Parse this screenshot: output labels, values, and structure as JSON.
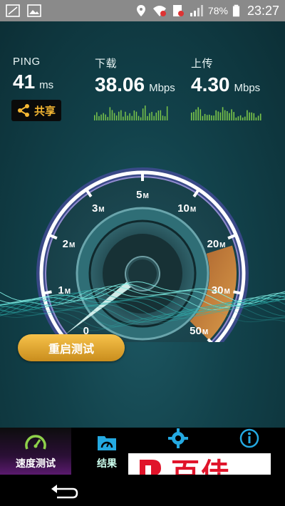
{
  "status_bar": {
    "battery": "78%",
    "time": "23:27"
  },
  "metrics": {
    "ping": {
      "label": "PING",
      "value": "41",
      "unit": "ms"
    },
    "download": {
      "label": "下载",
      "value": "38.06",
      "unit": "Mbps"
    },
    "upload": {
      "label": "上传",
      "value": "4.30",
      "unit": "Mbps"
    }
  },
  "share_label": "共享",
  "gauge": {
    "ticks": [
      {
        "num": "0",
        "unit": ""
      },
      {
        "num": "1",
        "unit": "M"
      },
      {
        "num": "2",
        "unit": "M"
      },
      {
        "num": "3",
        "unit": "M"
      },
      {
        "num": "5",
        "unit": "M"
      },
      {
        "num": "10",
        "unit": "M"
      },
      {
        "num": "20",
        "unit": "M"
      },
      {
        "num": "30",
        "unit": "M"
      },
      {
        "num": "50",
        "unit": "M"
      }
    ],
    "needle_value_mbps": 0.2,
    "accent": "#f5a623",
    "ring_color": "#c9b7ff"
  },
  "restart_label": "重启测试",
  "tabs": [
    {
      "label": "速度测试",
      "icon": "speedometer-icon",
      "active": true
    },
    {
      "label": "结果",
      "icon": "folder-gauge-icon",
      "active": false
    },
    {
      "label": "",
      "icon": "gear-icon",
      "active": false
    },
    {
      "label": "",
      "icon": "info-icon",
      "active": false
    }
  ],
  "watermark": {
    "text": "百佳"
  },
  "colors": {
    "download_bars": "#7bc64a",
    "upload_bars": "#7bc64a",
    "tab_icon": "#24a9e1",
    "speed_tab_icon": "#8ed14a"
  }
}
